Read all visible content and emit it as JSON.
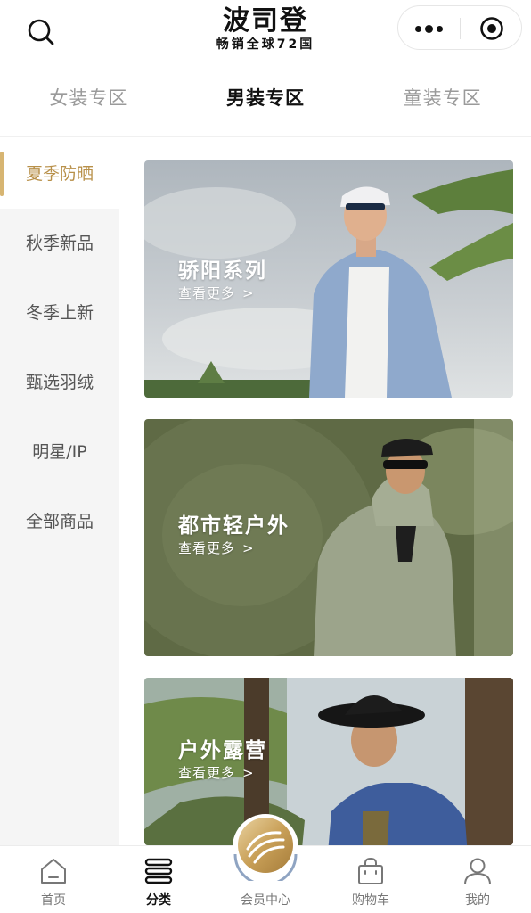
{
  "header": {
    "logo_title": "波司登",
    "logo_subtitle": "畅销全球72国",
    "icons": {
      "search": "search-icon",
      "more": "more-dots-icon",
      "close": "target-close-icon"
    }
  },
  "top_tabs": [
    {
      "label": "女装专区",
      "active": false
    },
    {
      "label": "男装专区",
      "active": true
    },
    {
      "label": "童装专区",
      "active": false
    }
  ],
  "sidebar": {
    "items": [
      {
        "label": "夏季防晒",
        "active": true
      },
      {
        "label": "秋季新品",
        "active": false
      },
      {
        "label": "冬季上新",
        "active": false
      },
      {
        "label": "甄选羽绒",
        "active": false
      },
      {
        "label": "明星/IP",
        "active": false
      },
      {
        "label": "全部商品",
        "active": false
      }
    ]
  },
  "banners": [
    {
      "title": "骄阳系列",
      "link": "查看更多"
    },
    {
      "title": "都市轻户外",
      "link": "查看更多"
    },
    {
      "title": "户外露营",
      "link": "查看更多"
    }
  ],
  "link_chevron": ">",
  "bottom_nav": [
    {
      "label": "首页",
      "icon": "home-icon",
      "active": false
    },
    {
      "label": "分类",
      "icon": "category-icon",
      "active": true
    },
    {
      "label": "会员中心",
      "icon": "member-badge-icon",
      "active": false
    },
    {
      "label": "购物车",
      "icon": "shopping-bag-icon",
      "active": false
    },
    {
      "label": "我的",
      "icon": "user-icon",
      "active": false
    }
  ],
  "colors": {
    "accent": "#b89049",
    "accent_bar": "#d7b572",
    "sidebar_bg": "#f5f5f5"
  }
}
